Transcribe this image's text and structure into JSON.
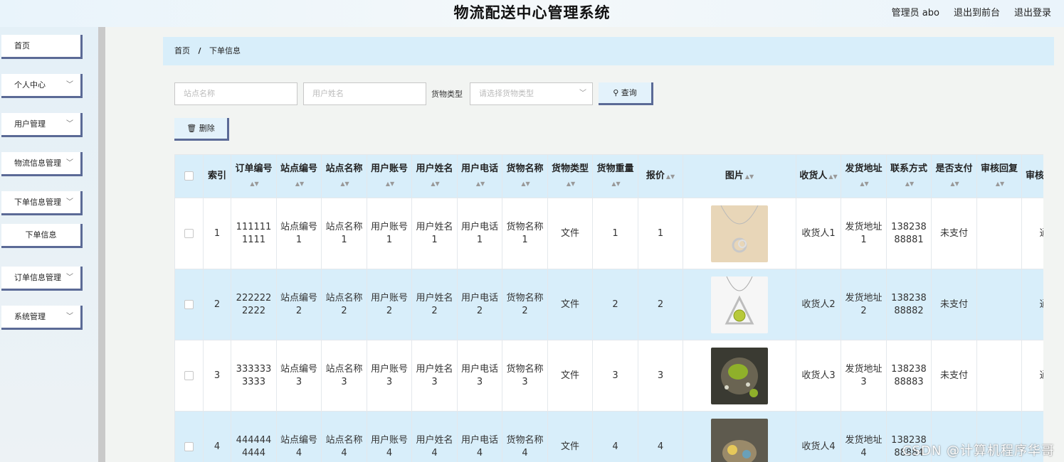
{
  "header": {
    "title": "物流配送中心管理系统",
    "user": "管理员 abo",
    "to_front": "退出到前台",
    "logout": "退出登录"
  },
  "sidebar": {
    "items": [
      {
        "label": "首页"
      },
      {
        "label": "个人中心"
      },
      {
        "label": "用户管理"
      },
      {
        "label": "物流信息管理"
      },
      {
        "label": "下单信息管理"
      },
      {
        "label": "下单信息"
      },
      {
        "label": "订单信息管理"
      },
      {
        "label": "系统管理"
      }
    ]
  },
  "breadcrumb": {
    "home": "首页",
    "sep": "/",
    "current": "下单信息"
  },
  "filters": {
    "station_name_placeholder": "站点名称",
    "user_name_placeholder": "用户姓名",
    "goods_type_label": "货物类型",
    "goods_type_placeholder": "请选择货物类型",
    "search_label": "查询",
    "delete_label": "删除"
  },
  "table": {
    "headers": [
      "索引",
      "订单编号",
      "站点编号",
      "站点名称",
      "用户账号",
      "用户姓名",
      "用户电话",
      "货物名称",
      "货物类型",
      "货物重量",
      "报价",
      "图片",
      "收货人",
      "发货地址",
      "联系方式",
      "是否支付",
      "审核回复",
      "审核状态"
    ],
    "rows": [
      {
        "index": "1",
        "order_no": "1111111111",
        "station_no": "站点编号1",
        "station_name": "站点名称1",
        "user_account": "用户账号1",
        "user_name": "用户姓名1",
        "user_phone": "用户电话1",
        "goods_name": "货物名称1",
        "goods_type": "文件",
        "weight": "1",
        "price": "1",
        "receiver": "收货人1",
        "address": "发货地址1",
        "contact": "13823888881",
        "paid": "未支付",
        "reply": "",
        "status": "通"
      },
      {
        "index": "2",
        "order_no": "2222222222",
        "station_no": "站点编号2",
        "station_name": "站点名称2",
        "user_account": "用户账号2",
        "user_name": "用户姓名2",
        "user_phone": "用户电话2",
        "goods_name": "货物名称2",
        "goods_type": "文件",
        "weight": "2",
        "price": "2",
        "receiver": "收货人2",
        "address": "发货地址2",
        "contact": "13823888882",
        "paid": "未支付",
        "reply": "",
        "status": "通"
      },
      {
        "index": "3",
        "order_no": "3333333333",
        "station_no": "站点编号3",
        "station_name": "站点名称3",
        "user_account": "用户账号3",
        "user_name": "用户姓名3",
        "user_phone": "用户电话3",
        "goods_name": "货物名称3",
        "goods_type": "文件",
        "weight": "3",
        "price": "3",
        "receiver": "收货人3",
        "address": "发货地址3",
        "contact": "13823888883",
        "paid": "未支付",
        "reply": "",
        "status": "通"
      },
      {
        "index": "4",
        "order_no": "4444444444",
        "station_no": "站点编号4",
        "station_name": "站点名称4",
        "user_account": "用户账号4",
        "user_name": "用户姓名4",
        "user_phone": "用户电话4",
        "goods_name": "货物名称4",
        "goods_type": "文件",
        "weight": "4",
        "price": "4",
        "receiver": "收货人4",
        "address": "发货地址4",
        "contact": "13823888884",
        "paid": "",
        "reply": "",
        "status": ""
      }
    ]
  },
  "watermark": "CSDN @计算机程序华哥",
  "colors": {
    "accent_border": "#5b6a96",
    "header_blue": "#d8eefa",
    "row_alt": "#d8eefa"
  }
}
